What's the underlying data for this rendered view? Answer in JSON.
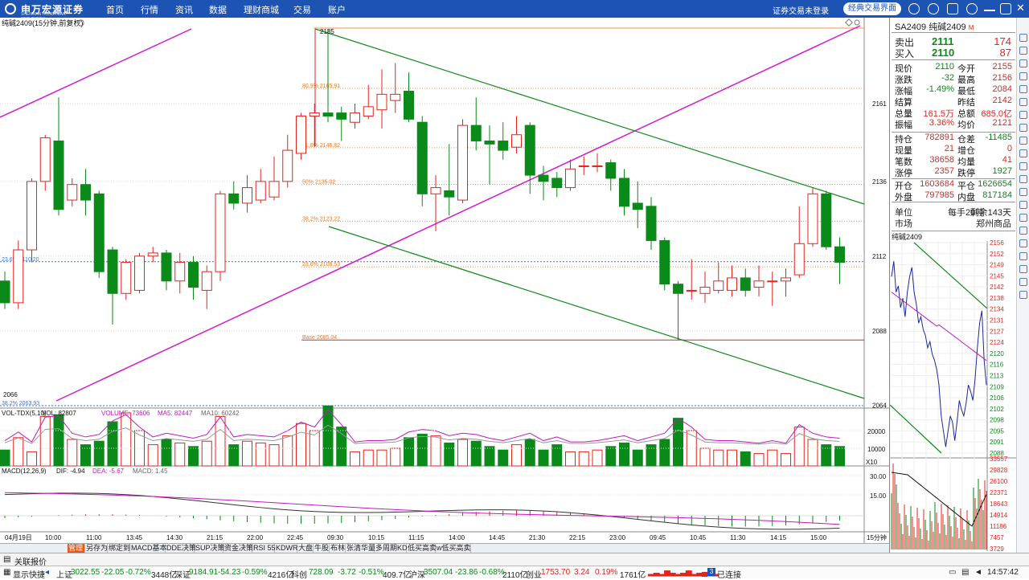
{
  "app": {
    "logo_text": "申万宏源证券",
    "logo_sub": "SHENWAN HONGYUAN SECURITIES",
    "menu": [
      "首页",
      "行情",
      "资讯",
      "数据",
      "理财商城",
      "交易",
      "账户"
    ],
    "login_status": "证券交易未登录",
    "classic_button": "经典交易界面"
  },
  "chart": {
    "title": "纯碱2409(15分钟,前复权)",
    "price_axis_labels": [
      "2161",
      "2136",
      "2112",
      "2088",
      "2064"
    ],
    "high_label": "2185",
    "low_label": "2066",
    "fib_labels": [
      "80.9% 2165.91",
      "61.8% 2146.82",
      "50% 2135.02",
      "38.2% 2123.22",
      "23.6% 2108.53",
      "Base 2085.04",
      "23.6% 2110.20",
      "38.2% 2063.93"
    ],
    "time_labels": [
      "04月19日",
      "10:00",
      "11:00",
      "13:45",
      "14:30",
      "21:15",
      "22:00",
      "22:45",
      "09:30",
      "10:15",
      "11:15",
      "14:00",
      "14:45",
      "21:30",
      "22:15",
      "23:00",
      "09:45",
      "10:45",
      "11:30",
      "14:15",
      "15:00"
    ],
    "period_label": "15分钟",
    "candles": [
      [
        2104,
        2097,
        2107,
        2095
      ],
      [
        2097,
        2114,
        2117,
        2095
      ],
      [
        2114,
        2136,
        2137,
        2110
      ],
      [
        2136,
        2150,
        2151,
        2133
      ],
      [
        2149,
        2127,
        2163,
        2125
      ],
      [
        2130,
        2135,
        2137,
        2128
      ],
      [
        2135,
        2130,
        2140,
        2125
      ],
      [
        2132,
        2107,
        2133,
        2105
      ],
      [
        2114,
        2100,
        2115,
        2090
      ],
      [
        2100,
        2110,
        2111,
        2098
      ],
      [
        2101,
        2112,
        2113,
        2100
      ],
      [
        2112,
        2113,
        2115,
        2110
      ],
      [
        2113,
        2104,
        2114,
        2101
      ],
      [
        2104,
        2110,
        2113,
        2100
      ],
      [
        2110,
        2102,
        2112,
        2098
      ],
      [
        2101,
        2107,
        2109,
        2095
      ],
      [
        2107,
        2132,
        2133,
        2104
      ],
      [
        2132,
        2129,
        2136,
        2127
      ],
      [
        2129,
        2134,
        2138,
        2126
      ],
      [
        2130,
        2136,
        2140,
        2129
      ],
      [
        2131,
        2136,
        2144,
        2130
      ],
      [
        2136,
        2146,
        2151,
        2134
      ],
      [
        2145,
        2157,
        2158,
        2143
      ],
      [
        2157,
        2158,
        2161,
        2147
      ],
      [
        2158,
        2157,
        2185,
        2155
      ],
      [
        2158,
        2156,
        2160,
        2149
      ],
      [
        2155,
        2158,
        2161,
        2153
      ],
      [
        2157,
        2160,
        2167,
        2156
      ],
      [
        2159,
        2164,
        2172,
        2153
      ],
      [
        2162,
        2164,
        2174,
        2158
      ],
      [
        2165,
        2156,
        2171,
        2155
      ],
      [
        2155,
        2132,
        2157,
        2128
      ],
      [
        2132,
        2134,
        2138,
        2120
      ],
      [
        2133,
        2131,
        2148,
        2125
      ],
      [
        2130,
        2154,
        2156,
        2129
      ],
      [
        2154,
        2149,
        2163,
        2146
      ],
      [
        2149,
        2148,
        2154,
        2135
      ],
      [
        2149,
        2146,
        2155,
        2143
      ],
      [
        2147,
        2151,
        2157,
        2145
      ],
      [
        2154,
        2138,
        2155,
        2132
      ],
      [
        2138,
        2136,
        2141,
        2130
      ],
      [
        2137,
        2134,
        2139,
        2131
      ],
      [
        2134,
        2140,
        2143,
        2133
      ],
      [
        2141,
        2141,
        2144,
        2138
      ],
      [
        2141,
        2141,
        2145,
        2139
      ],
      [
        2142,
        2137,
        2143,
        2133
      ],
      [
        2137,
        2128,
        2140,
        2125
      ],
      [
        2129,
        2127,
        2136,
        2121
      ],
      [
        2128,
        2117,
        2131,
        2114
      ],
      [
        2117,
        2103,
        2118,
        2101
      ],
      [
        2103,
        2100,
        2104,
        2085
      ],
      [
        2101,
        2101,
        2111,
        2098
      ],
      [
        2100,
        2102,
        2107,
        2097
      ],
      [
        2101,
        2104,
        2110,
        2100
      ],
      [
        2101,
        2105,
        2109,
        2099
      ],
      [
        2105,
        2101,
        2108,
        2099
      ],
      [
        2102,
        2104,
        2109,
        2099
      ],
      [
        2104,
        2104,
        2107,
        2096
      ],
      [
        2104,
        2105,
        2108,
        2099
      ],
      [
        2106,
        2116,
        2128,
        2105
      ],
      [
        2116,
        2132,
        2134,
        2115
      ],
      [
        2132,
        2115,
        2133,
        2114
      ],
      [
        2115,
        2110,
        2118,
        2103
      ]
    ],
    "volume": {
      "header": "VOL-TDX(5,10)",
      "vol": "VOL: 82807",
      "volume": "VOLUME: 73606",
      "ma5": "MA5: 82447",
      "ma10": "MA10: 60242",
      "axis": [
        "20000",
        "10000",
        "X10"
      ]
    },
    "macd": {
      "header": "MACD(12,26,9)",
      "dif": "DIF: -4.94",
      "dea": "DEA: -5.67",
      "macd": "MACD: 1.45",
      "axis": [
        "30.00",
        "15.00"
      ]
    }
  },
  "quote": {
    "symbol": "SA2409 纯碱2409",
    "badge": "M",
    "ask_label": "卖出",
    "ask_price": "2111",
    "ask_vol": "174",
    "bid_label": "买入",
    "bid_price": "2110",
    "bid_vol": "87",
    "rows": [
      [
        "现价",
        "2110",
        "今开",
        "2155"
      ],
      [
        "涨跌",
        "-32",
        "最高",
        "2156"
      ],
      [
        "涨幅",
        "-1.49%",
        "最低",
        "2084"
      ],
      [
        "结算",
        "",
        "昨结",
        "2142"
      ],
      [
        "总量",
        "161.5万",
        "总额",
        "685.0亿"
      ],
      [
        "振幅",
        "3.36%",
        "均价",
        "2121"
      ]
    ],
    "rows2": [
      [
        "持仓",
        "782891",
        "仓差",
        "-11485"
      ],
      [
        "现量",
        "21",
        "增仓",
        "0"
      ],
      [
        "笔数",
        "38658",
        "均量",
        "41"
      ],
      [
        "涨停",
        "2357",
        "跌停",
        "1927"
      ]
    ],
    "rows3": [
      [
        "开仓",
        "1603684",
        "平仓",
        "1626654"
      ],
      [
        "外盘",
        "797985",
        "内盘",
        "817184"
      ]
    ],
    "unit_label": "单位",
    "unit_value": "每手20吨",
    "remain_value": "剩余143天",
    "market_label": "市场",
    "market_value": "郑州商品",
    "mini_title": "纯碱2409",
    "mini_price_labels": [
      "2156",
      "2152",
      "2149",
      "2145",
      "2142",
      "2138",
      "2134",
      "2131",
      "2127",
      "2124",
      "2120",
      "2116",
      "2113",
      "2109",
      "2106",
      "2102",
      "2098",
      "2095",
      "2091",
      "2088"
    ],
    "mini_vol_labels": [
      "33557",
      "29828",
      "26100",
      "22371",
      "18643",
      "14914",
      "11186",
      "7457",
      "3729"
    ],
    "chart_tabs": [
      "笔",
      "价",
      "细",
      "势",
      "联",
      "值",
      "主",
      "筹"
    ]
  },
  "bottom_tabs": [
    "管理",
    "另存为",
    "绑定到",
    "MACD基本",
    "DDE决策",
    "SUP决策",
    "资金决策",
    "RSI 55",
    "KDWR",
    "大盘",
    "牛股",
    "布林",
    "张清华量",
    "多周期KD",
    "低买高卖",
    "w低买高卖"
  ],
  "status": {
    "quote_tab": "关联报价",
    "left": "显示快捷",
    "sh_label": "上证",
    "sh_val": "3022.55",
    "sh_chg": "-22.05",
    "sh_pct": "-0.72%",
    "sh_amt": "3448亿",
    "sz_label": "深证",
    "sz_val": "9184.91",
    "sz_chg": "-54.23",
    "sz_pct": "-0.59%",
    "sz_amt": "4216亿",
    "kc_label": "科创",
    "kc_val": "728.09",
    "kc_chg": "-3.72",
    "kc_pct": "-0.51%",
    "kc_amt": "409.7亿",
    "hs_label": "沪深",
    "hs_val": "3507.04",
    "hs_chg": "-23.86",
    "hs_pct": "-0.68%",
    "hs_amt": "2110亿",
    "cy_label": "创业",
    "cy_val": "1753.70",
    "cy_chg": "3.24",
    "cy_pct": "0.19%",
    "cy_amt": "1761亿",
    "conn": "已连接",
    "clock": "14:57:42"
  },
  "colors": {
    "topbar": "#1d54b4",
    "up": "#e0261c",
    "down": "#0a8a18",
    "trend_magenta": "#d21ad2"
  }
}
